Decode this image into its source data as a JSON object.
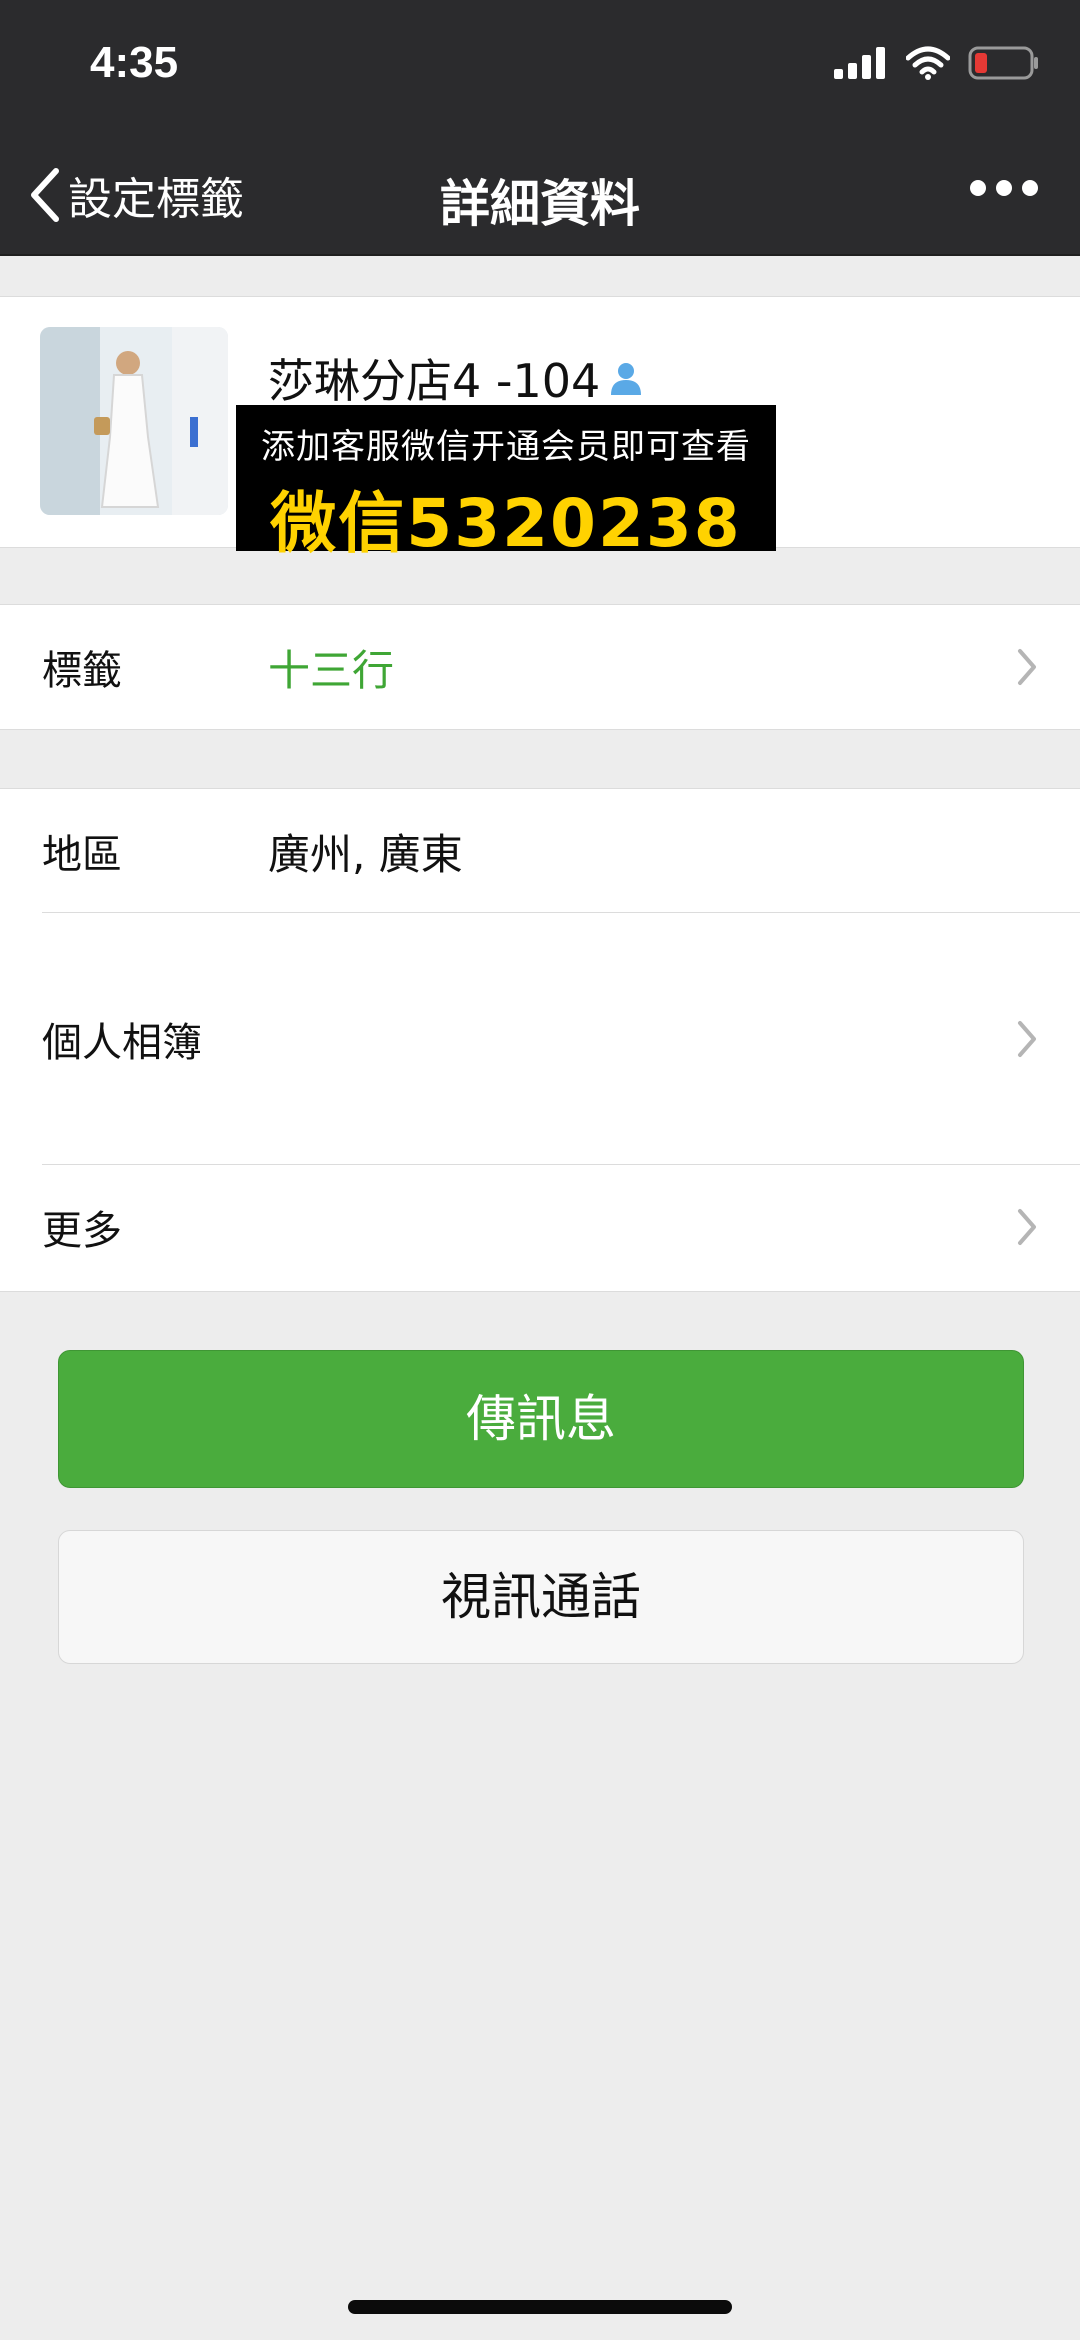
{
  "status": {
    "time": "4:35"
  },
  "nav": {
    "back_label": "設定標籤",
    "title": "詳細資料"
  },
  "profile": {
    "name": "莎琳分店4 -104",
    "promo_line1": "添加客服微信开通会员即可查看",
    "promo_line2": "微信5320238"
  },
  "tag_row": {
    "label": "標籤",
    "value": "十三行"
  },
  "region_row": {
    "label": "地區",
    "value": "廣州, 廣東"
  },
  "album_row": {
    "label": "個人相簿"
  },
  "more_row": {
    "label": "更多"
  },
  "buttons": {
    "send": "傳訊息",
    "video": "視訊通話"
  },
  "colors": {
    "accent_green": "#4aac3d",
    "label_green": "#3fa635",
    "promo_yellow": "#ffd200",
    "battery_low": "#e53935"
  },
  "icons": [
    "signal-icon",
    "wifi-icon",
    "battery-icon",
    "back-chevron-icon",
    "more-dots-icon",
    "person-icon",
    "chevron-right-icon"
  ]
}
